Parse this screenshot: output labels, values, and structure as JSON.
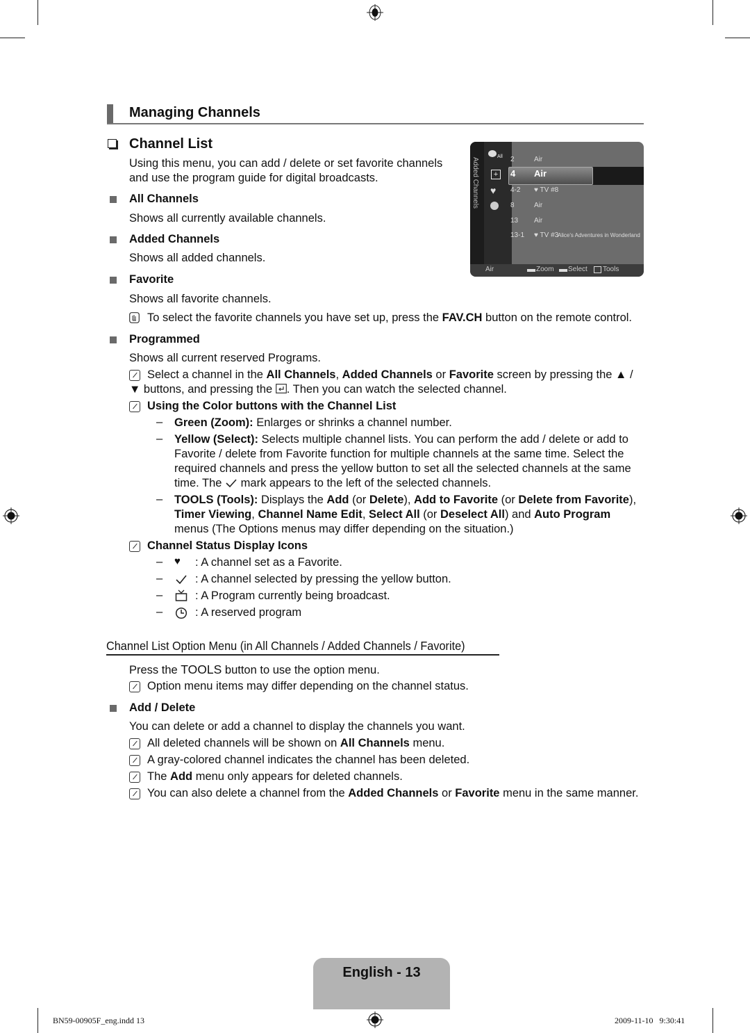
{
  "section_title": "Managing Channels",
  "subsection_title": "Channel List",
  "intro": [
    "Using this menu, you can add / delete or set favorite channels",
    "and use the program guide for digital broadcasts."
  ],
  "items": [
    {
      "title": "All Channels",
      "desc": "Shows all currently available channels."
    },
    {
      "title": "Added Channels",
      "desc": "Shows all added channels."
    },
    {
      "title": "Favorite",
      "desc": "Shows all favorite channels."
    },
    {
      "title": "Programmed",
      "desc": "Shows all current reserved Programs."
    }
  ],
  "fav_note": {
    "pre": "To select the favorite channels you have set up, press the ",
    "bold": "FAV.CH",
    "post": " button on the remote control."
  },
  "select_note": {
    "line1": [
      {
        "t": "Select a channel in the ",
        "b": false
      },
      {
        "t": "All Channels",
        "b": true
      },
      {
        "t": ", ",
        "b": false
      },
      {
        "t": "Added Channels",
        "b": true
      },
      {
        "t": " or ",
        "b": false
      },
      {
        "t": "Favorite",
        "b": true
      },
      {
        "t": " screen by pressing the ▲ /",
        "b": false
      }
    ],
    "line2_pre": "▼ buttons, and pressing the ",
    "line2_post": ". Then you can watch the selected channel."
  },
  "color_buttons": {
    "heading": "Using the Color buttons with the Channel List",
    "green": {
      "label": "Green (Zoom):",
      "text": " Enlarges or shrinks a channel number."
    },
    "yellow": {
      "label": "Yellow (Select):",
      "text1": " Selects multiple channel lists. You can perform the add / delete or add to",
      "line2": "Favorite / delete from Favorite function for multiple channels at the same time. Select the",
      "line3": "required channels and press the yellow button to set all the selected channels at the same",
      "line4_pre": "time. The ",
      "line4_post": " mark appears to the left of the selected channels."
    },
    "tools": {
      "line1": [
        {
          "t": "TOOLS (Tools):",
          "b": true
        },
        {
          "t": " Displays the ",
          "b": false
        },
        {
          "t": "Add",
          "b": true
        },
        {
          "t": " (or ",
          "b": false
        },
        {
          "t": "Delete",
          "b": true
        },
        {
          "t": "), ",
          "b": false
        },
        {
          "t": "Add to Favorite",
          "b": true
        },
        {
          "t": " (or ",
          "b": false
        },
        {
          "t": "Delete from Favorite",
          "b": true
        },
        {
          "t": "),",
          "b": false
        }
      ],
      "line2": [
        {
          "t": "Timer Viewing",
          "b": true
        },
        {
          "t": ", ",
          "b": false
        },
        {
          "t": "Channel Name Edit",
          "b": true
        },
        {
          "t": ", ",
          "b": false
        },
        {
          "t": "Select All",
          "b": true
        },
        {
          "t": " (or ",
          "b": false
        },
        {
          "t": "Deselect All",
          "b": true
        },
        {
          "t": ") and ",
          "b": false
        },
        {
          "t": "Auto Program",
          "b": true
        }
      ],
      "line3": "menus (The Options menus may differ depending on the situation.)"
    }
  },
  "status_icons": {
    "heading": "Channel Status Display Icons",
    "items": [
      {
        "icon": "heart-icon",
        "text": ": A channel set as a Favorite."
      },
      {
        "icon": "check-icon",
        "text": ": A channel selected by pressing the yellow button."
      },
      {
        "icon": "tv-icon",
        "text": ": A Program currently being broadcast."
      },
      {
        "icon": "clock-icon",
        "text": ": A reserved program"
      }
    ]
  },
  "option_menu": {
    "heading": "Channel List Option Menu (in All Channels / Added Channels / Favorite)",
    "press_pre": "Press the ",
    "press_key": "TOOLS",
    "press_post": " button to use the option menu.",
    "note": "Option menu items may differ depending on the channel status."
  },
  "add_delete": {
    "title": "Add / Delete",
    "desc": "You can delete or add a channel to display the channels you want.",
    "notes": [
      [
        {
          "t": "All deleted channels will be shown on ",
          "b": false
        },
        {
          "t": "All Channels",
          "b": true
        },
        {
          "t": " menu.",
          "b": false
        }
      ],
      [
        {
          "t": "A gray-colored channel indicates the channel has been deleted.",
          "b": false
        }
      ],
      [
        {
          "t": "The ",
          "b": false
        },
        {
          "t": "Add",
          "b": true
        },
        {
          "t": " menu only appears for deleted channels.",
          "b": false
        }
      ],
      [
        {
          "t": "You can also delete a channel from the ",
          "b": false
        },
        {
          "t": "Added Channels",
          "b": true
        },
        {
          "t": " or ",
          "b": false
        },
        {
          "t": "Favorite",
          "b": true
        },
        {
          "t": " menu in the same manner.",
          "b": false
        }
      ]
    ]
  },
  "tv_screen": {
    "side_label": "Added Channels",
    "all_label": "All",
    "rows": [
      {
        "num": "2",
        "fav": false,
        "name": "Air",
        "program": ""
      },
      {
        "num": "4",
        "fav": false,
        "name": "Air",
        "program": "",
        "selected": true
      },
      {
        "num": "4-2",
        "fav": true,
        "name": "TV #8",
        "program": ""
      },
      {
        "num": "8",
        "fav": false,
        "name": "Air",
        "program": ""
      },
      {
        "num": "13",
        "fav": false,
        "name": "Air",
        "program": ""
      },
      {
        "num": "13-1",
        "fav": true,
        "name": "TV #3",
        "program": "Alice's Adventures in Wonderland"
      }
    ],
    "bottom": {
      "source": "Air",
      "zoom": "Zoom",
      "select": "Select",
      "tools": "Tools"
    }
  },
  "page_label": "English - 13",
  "footer": {
    "file": "BN59-00905F_eng.indd   13",
    "timestamp": "2009-11-10   9:30:41"
  }
}
